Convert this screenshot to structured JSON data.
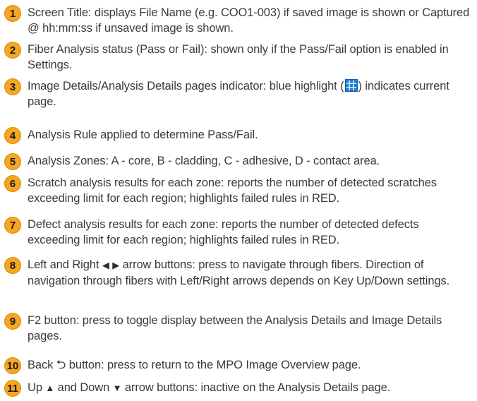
{
  "items": [
    {
      "num": "1",
      "text": "Screen Title: displays File Name (e.g. COO1-003) if saved image is shown or Captured @ hh:mm:ss if unsaved image is shown."
    },
    {
      "num": "2",
      "text": "Fiber Analysis status (Pass or Fail): shown only if the Pass/Fail option is enabled in Settings."
    },
    {
      "num": "3",
      "text_before": "Image Details/Analysis Details pages indicator: blue highlight (",
      "text_after": ") indicates current page."
    },
    {
      "num": "4",
      "text": "Analysis Rule applied to determine Pass/Fail."
    },
    {
      "num": "5",
      "text": "Analysis Zones: A - core, B - cladding, C - adhesive, D - contact area."
    },
    {
      "num": "6",
      "text": "Scratch analysis results for each zone: reports the number of detected scratches exceeding limit for each region; highlights failed rules in RED."
    },
    {
      "num": "7",
      "text": "Defect analysis results for each zone: reports the number of detected defects exceeding limit for each region; highlights failed rules in RED."
    },
    {
      "num": "8",
      "text_before": "Left and Right ",
      "left_arrow": "◀",
      "right_arrow": "▶",
      "text_after": " arrow buttons: press to navigate through fibers. Direction of navigation through fibers with Left/Right arrows depends on Key Up/Down settings."
    },
    {
      "num": "9",
      "text": "F2 button: press to toggle display between the Analysis Details and Image Details pages."
    },
    {
      "num": "10",
      "text_before": "Back ",
      "back_arrow": "⮌",
      "text_after": " button: press to return to the MPO Image Overview page."
    },
    {
      "num": "11",
      "text_before": "Up ",
      "up_arrow": "▲",
      "text_mid": " and Down ",
      "down_arrow": "▼",
      "text_after": " arrow buttons: inactive on the Analysis Details page."
    }
  ],
  "colors": {
    "badge": "#f5a623",
    "highlight": "#1e7fd8"
  },
  "icons": {
    "page_indicator": "grid-icon"
  }
}
